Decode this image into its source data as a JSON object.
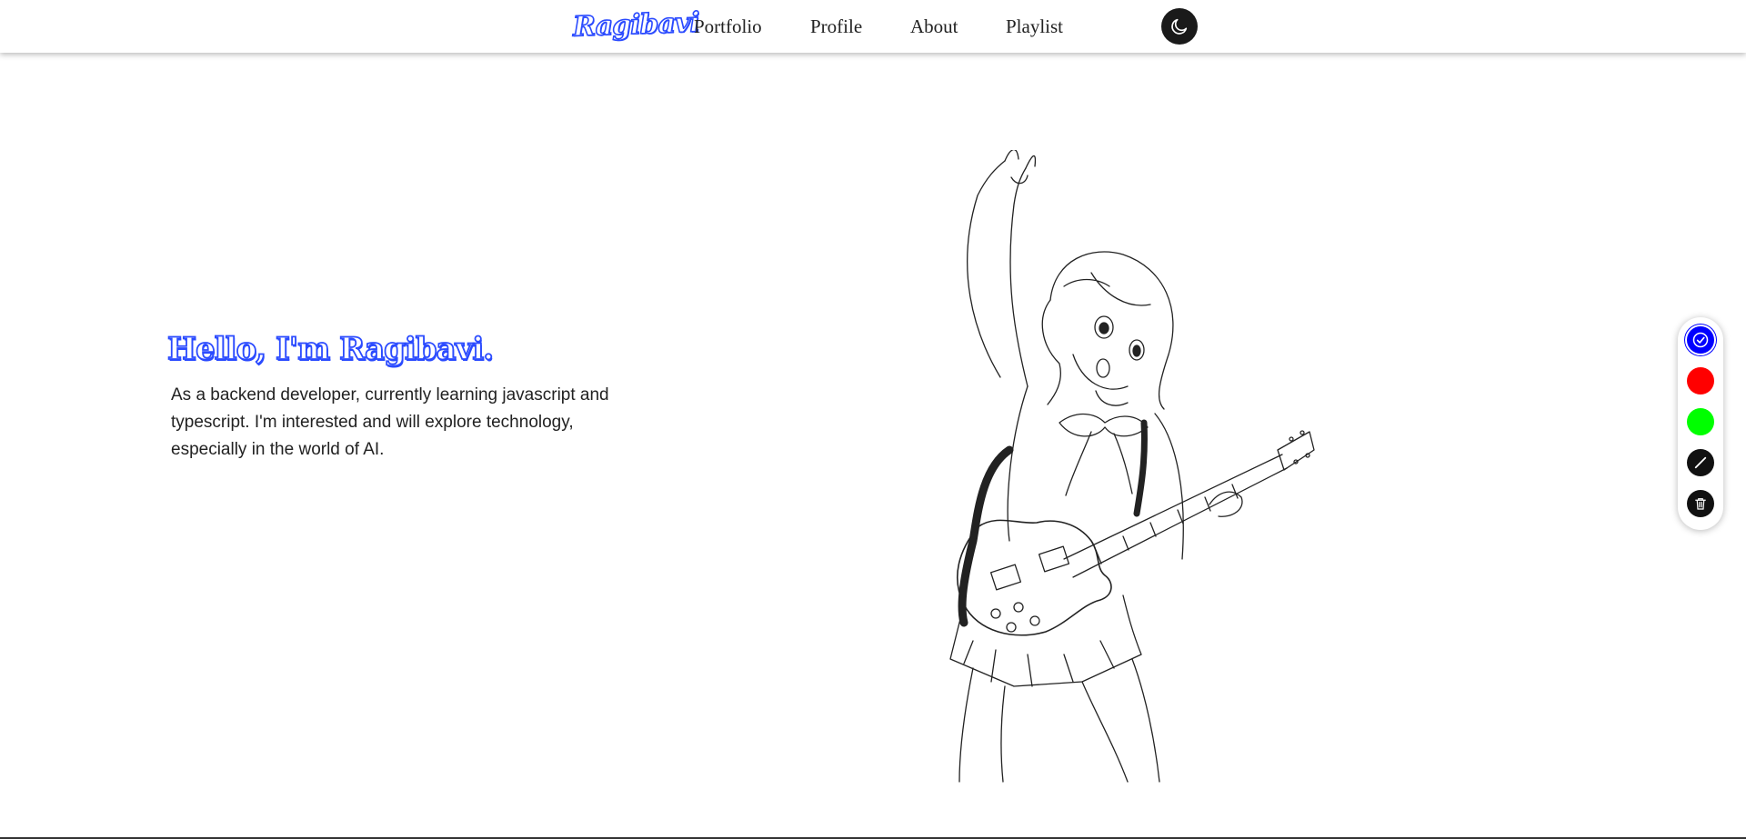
{
  "header": {
    "logo": "Ragibavi",
    "nav": [
      {
        "label": "Portfolio"
      },
      {
        "label": "Profile"
      },
      {
        "label": "About"
      },
      {
        "label": "Playlist"
      }
    ],
    "theme_toggle_icon": "moon-icon"
  },
  "hero": {
    "title": "Hello, I'm Ragibavi.",
    "description": "As a backend developer, currently learning javascript and typescript. I'm interested and will explore technology, especially in the world of AI.",
    "illustration": "anime-girl-guitar-lineart"
  },
  "tools": {
    "items": [
      {
        "name": "blue-color",
        "color": "#0000ff",
        "icon": "check-icon",
        "selected": true
      },
      {
        "name": "red-color",
        "color": "#ff0000"
      },
      {
        "name": "green-color",
        "color": "#00ff00"
      },
      {
        "name": "black-pen",
        "color": "#111111",
        "icon": "pen-icon"
      },
      {
        "name": "clear",
        "color": "#111111",
        "icon": "trash-icon"
      }
    ]
  },
  "colors": {
    "accent": "#2b4bff",
    "dark": "#1a1a1a"
  }
}
